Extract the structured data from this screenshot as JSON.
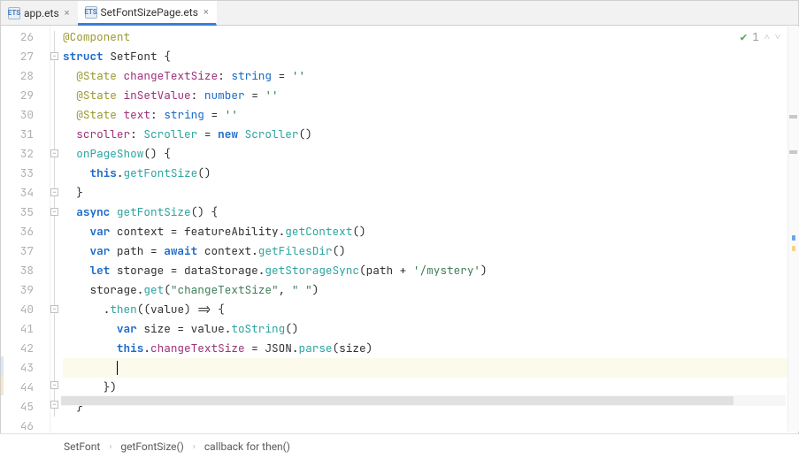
{
  "tabs": [
    {
      "label": "app.ets",
      "active": false
    },
    {
      "label": "SetFontSizePage.ets",
      "active": true
    }
  ],
  "inspection": {
    "count": "1"
  },
  "line_numbers": [
    "26",
    "27",
    "28",
    "29",
    "30",
    "31",
    "32",
    "33",
    "34",
    "35",
    "36",
    "37",
    "38",
    "39",
    "40",
    "41",
    "42",
    "43",
    "44",
    "45",
    "46"
  ],
  "code": {
    "l26": {
      "annotation": "@Component"
    },
    "l27": {
      "kw": "struct",
      "name": "SetFont",
      "brace": " {"
    },
    "l28": {
      "ann": "@State",
      "field": "changeTextSize",
      "colon": ": ",
      "type": "string",
      "eq": " = ",
      "str": "''"
    },
    "l29": {
      "ann": "@State",
      "field": "inSetValue",
      "colon": ": ",
      "type": "number",
      "eq": " = ",
      "str": "''"
    },
    "l30": {
      "ann": "@State",
      "field": "text",
      "colon": ": ",
      "type": "string",
      "eq": " = ",
      "str": "''"
    },
    "l31": {
      "field": "scroller",
      "colon": ": ",
      "type1": "Scroller",
      "eq": " = ",
      "kw": "new",
      "type2": " Scroller",
      "paren": "()"
    },
    "l32": {
      "name": "onPageShow",
      "paren": "() ",
      "brace": "{"
    },
    "l33": {
      "this": "this",
      "dot": ".",
      "call": "getFontSize",
      "paren": "()"
    },
    "l34": {
      "brace": "}"
    },
    "l35": {
      "kw": "async",
      "name": " getFontSize",
      "paren": "() ",
      "brace": "{"
    },
    "l36": {
      "kw": "var",
      "name": " context = ",
      "obj": "featureAbility",
      "dot": ".",
      "call": "getContext",
      "paren": "()"
    },
    "l37": {
      "kw": "var",
      "name": " path = ",
      "kw2": "await",
      "obj": " context",
      "dot": ".",
      "call": "getFilesDir",
      "paren": "()"
    },
    "l38": {
      "kw": "let",
      "name": " storage = ",
      "obj": "dataStorage",
      "dot": ".",
      "call": "getStorageSync",
      "paren1": "(",
      "arg": "path + ",
      "str": "'/mystery'",
      "paren2": ")"
    },
    "l39": {
      "obj": "storage",
      "dot": ".",
      "call": "get",
      "paren1": "(",
      "str1": "\"changeTextSize\"",
      "comma": ", ",
      "str2": "\" \"",
      "paren2": ")"
    },
    "l40": {
      "dot": ".",
      "call": "then",
      "paren1": "((",
      "arg": "value",
      "paren2": ") => {"
    },
    "l41": {
      "kw": "var",
      "name": " size = value.",
      "call": "toString",
      "paren": "()"
    },
    "l42": {
      "this": "this",
      "dot": ".",
      "field": "changeTextSize",
      "eq": " = ",
      "obj": "JSON",
      "dot2": ".",
      "call": "parse",
      "paren1": "(",
      "arg": "size",
      "paren2": ")"
    },
    "l44": {
      "brace": "})"
    },
    "l45": {
      "brace": "}"
    }
  },
  "breadcrumb": {
    "item1": "SetFont",
    "item2": "getFontSize()",
    "item3": "callback for then()"
  }
}
